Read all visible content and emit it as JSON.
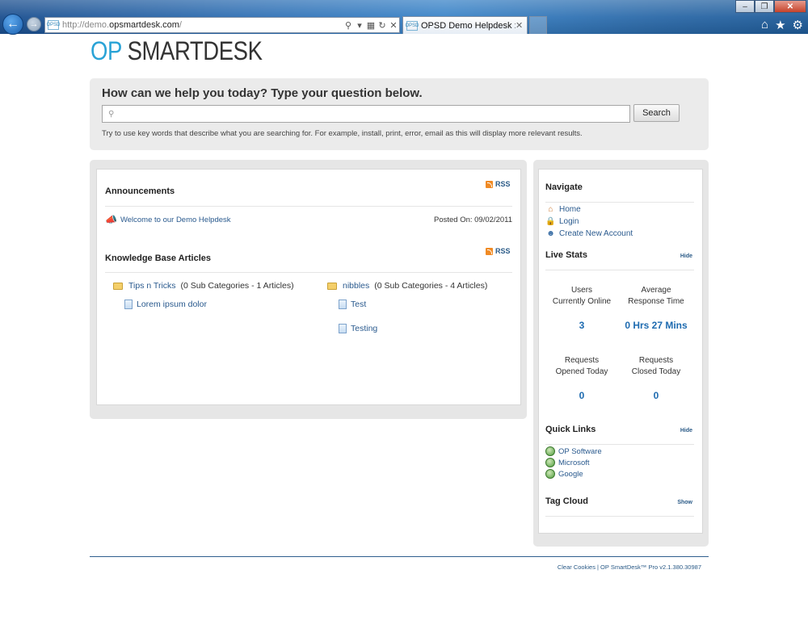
{
  "browser": {
    "url_prefix": "http://demo.",
    "url_domain": "opsmartdesk.com",
    "url_suffix": "/",
    "favicon_text": "OPSD",
    "tab_title": "OPSD Demo Helpdesk :: Ho...",
    "tab_close": "✕"
  },
  "logo": {
    "op": "OP",
    "rest": " SMARTDESK"
  },
  "search": {
    "heading": "How can we help you today? Type your question below.",
    "placeholder": "",
    "value": "",
    "button_label": "Search",
    "hint": "Try to use key words that describe what you are searching for. For example, install, print, error, email as this will display more relevant results."
  },
  "announcements": {
    "title": "Announcements",
    "rss_label": "RSS",
    "items": [
      {
        "title": "Welcome to our Demo Helpdesk",
        "posted": "Posted On: 09/02/2011"
      }
    ]
  },
  "knowledge_base": {
    "title": "Knowledge Base Articles",
    "rss_label": "RSS",
    "categories": [
      {
        "name": "Tips n Tricks",
        "count": "(0 Sub Categories - 1 Articles)",
        "articles": [
          "Lorem ipsum dolor"
        ]
      },
      {
        "name": "nibbles",
        "count": "(0 Sub Categories - 4 Articles)",
        "articles": [
          "Test",
          "Testing"
        ]
      }
    ]
  },
  "sidebar": {
    "navigate": {
      "title": "Navigate",
      "items": [
        "Home",
        "Login",
        "Create New Account"
      ]
    },
    "live_stats": {
      "title": "Live Stats",
      "toggle": "Hide",
      "stats": [
        {
          "label_line1": "Users",
          "label_line2": "Currently Online",
          "value": "3"
        },
        {
          "label_line1": "Average",
          "label_line2": "Response Time",
          "value": "0 Hrs 27 Mins"
        },
        {
          "label_line1": "Requests",
          "label_line2": "Opened Today",
          "value": "0"
        },
        {
          "label_line1": "Requests",
          "label_line2": "Closed Today",
          "value": "0"
        }
      ]
    },
    "quick_links": {
      "title": "Quick Links",
      "toggle": "Hide",
      "items": [
        "OP Software",
        "Microsoft",
        "Google"
      ]
    },
    "tag_cloud": {
      "title": "Tag Cloud",
      "toggle": "Show"
    }
  },
  "footer": {
    "text": "Clear Cookies | OP SmartDesk™ Pro v2.1.380.30987"
  }
}
